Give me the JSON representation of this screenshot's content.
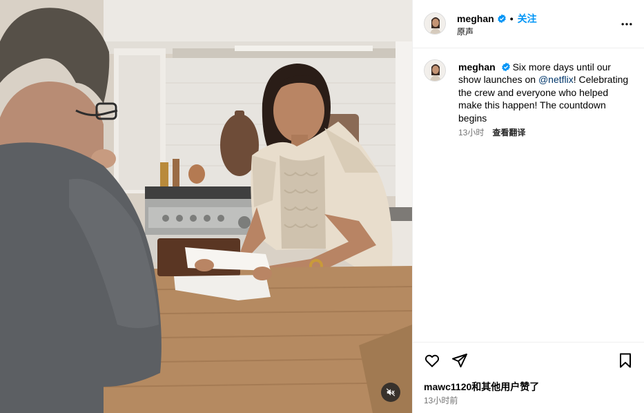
{
  "post": {
    "username": "meghan",
    "verified": true,
    "follow_label": "关注",
    "audio_label": "原声",
    "caption": {
      "username": "meghan",
      "text_before": "Six more days until our show launches on ",
      "mention": "@netflix",
      "text_after": "! Celebrating the crew and everyone who helped make this happen! The countdown begins"
    },
    "caption_time": "13小时",
    "translate_label": "查看翻译",
    "likes_text": "mawc1120和其他用户赞了",
    "posted_time": "13小时前"
  },
  "colors": {
    "follow_blue": "#0095f6",
    "verified_blue": "#0095f6",
    "mention_navy": "#00376b",
    "secondary_gray": "#737373"
  },
  "icons": {
    "more": "more-horizontal-icon",
    "verified": "verified-badge-icon",
    "like": "heart-icon",
    "share": "paper-plane-icon",
    "save": "bookmark-icon",
    "mute": "audio-muted-icon"
  }
}
